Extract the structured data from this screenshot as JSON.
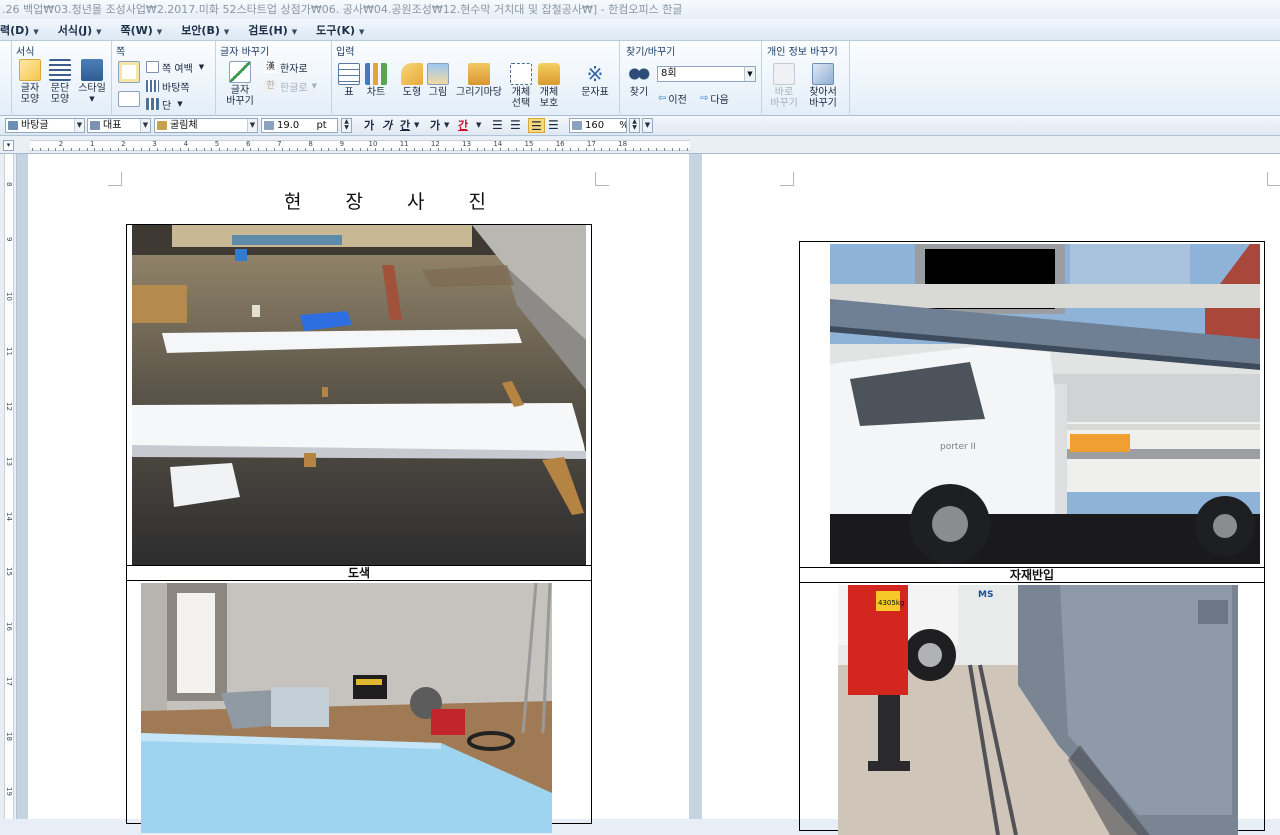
{
  "window": {
    "title": ".26 백업₩03.청년몰 조성사업₩2.2017.미화 52스타트업 상점가₩06. 공사₩04.공원조성₩12.현수막 거치대 및 잡철공사₩] - 한컴오피스 한글"
  },
  "menu": [
    "력(D)",
    "서식(J)",
    "쪽(W)",
    "보안(B)",
    "검토(H)",
    "도구(K)"
  ],
  "ribbon": {
    "groups": {
      "format": "서식",
      "page": "쪽",
      "char_replace": "글자 바꾸기",
      "input": "입력",
      "find_replace": "찾기/바꾸기",
      "privacy": "개인 정보 바꾸기"
    },
    "format": {
      "char_shape": "글자\n모양",
      "para_shape": "문단\n모양",
      "style": "스타일"
    },
    "page": {
      "margin": "쪽 여백",
      "background": "바탕쪽",
      "column": "단"
    },
    "char_replace": {
      "replace": "글자\n바꾸기",
      "to_hanja": "한자로",
      "to_hangul": "한글로"
    },
    "input": {
      "table": "표",
      "chart": "차트",
      "shape": "도형",
      "picture": "그림",
      "draw_market": "그리기마당",
      "object_select": "개체\n선택",
      "object_protect": "개체\n보호",
      "char_map": "문자표"
    },
    "find": {
      "find": "찾기",
      "find_value": "8회",
      "prev": "이전",
      "next": "다음"
    },
    "privacy": {
      "instant": "바로\n바꾸기",
      "search": "찾아서\n바꾸기"
    }
  },
  "format_bar": {
    "style": "바탕글",
    "lang": "대표",
    "font": "굴림체",
    "size": "19.0",
    "unit": "pt",
    "bold": "가",
    "italic": "가",
    "underline": "간",
    "strike": "가",
    "color": "간",
    "zoom": "160",
    "zoom_unit": "%"
  },
  "ruler": {
    "h_ticks": [
      "2",
      "1",
      "2",
      "3",
      "4",
      "5",
      "6",
      "7",
      "8",
      "9",
      "10",
      "11",
      "12",
      "13",
      "14",
      "15",
      "16",
      "17",
      "18"
    ],
    "v_ticks": [
      "8",
      "9",
      "10",
      "11",
      "12",
      "13",
      "14",
      "15",
      "16",
      "17",
      "18",
      "19"
    ]
  },
  "document": {
    "left_page": {
      "title": "현 장 사 진",
      "captions": [
        "도색"
      ]
    },
    "right_page": {
      "captions": [
        "자재반입"
      ]
    },
    "truck_logo": "porter II",
    "crane_label": "4305kg",
    "crane_brand": "MS"
  }
}
